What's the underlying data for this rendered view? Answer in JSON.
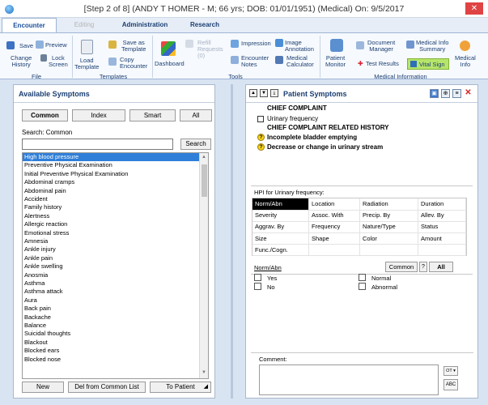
{
  "window": {
    "title": "[Step 2 of 8] (ANDY T HOMER - M; 66 yrs; DOB: 01/01/1951) (Medical) On: 9/5/2017",
    "close_glyph": "✕"
  },
  "tabs": [
    {
      "label": "Encounter"
    },
    {
      "label": "Editing"
    },
    {
      "label": "Administration"
    },
    {
      "label": "Research"
    }
  ],
  "ribbon": {
    "file": {
      "save": "Save",
      "preview": "Preview",
      "change_history": "Change\nHistory",
      "lock_screen": "Lock\nScreen",
      "group": "File"
    },
    "templates": {
      "load_template": "Load\nTemplate",
      "save_as_template": "Save as\nTemplate",
      "copy_encounter": "Copy\nEncounter",
      "group": "Templates"
    },
    "tools": {
      "dashboard": "Dashboard",
      "refill_requests": "Refill\nRequests\n(0)",
      "impression": "Impression",
      "image_annotation": "Image\nAnnotation",
      "encounter_notes": "Encounter\nNotes",
      "medical_calculator": "Medical\nCalculator",
      "group": "Tools"
    },
    "medical_info": {
      "patient_monitor": "Patient\nMonitor",
      "document_manager": "Document\nManager",
      "medical_info_summary": "Medical Info\nSummary",
      "test_results": "Test Results",
      "vital_sign": "Vital Sign",
      "medical_info": "Medical\nInfo",
      "group": "Medical Information"
    }
  },
  "available_symptoms": {
    "title": "Available Symptoms",
    "filters": [
      "Common",
      "Index",
      "Smart",
      "All"
    ],
    "search_label": "Search: Common",
    "search_value": "",
    "search_button": "Search",
    "items": [
      "High blood pressure",
      "Preventive Physical Examination",
      "Initial Preventive Physical Examination",
      "Abdominal cramps",
      "Abdominal pain",
      "Accident",
      "Family history",
      "Alertness",
      "Allergic reaction",
      "Emotional stress",
      "Amnesia",
      "Ankle injury",
      "Ankle pain",
      "Ankle swelling",
      "Anosmia",
      "Asthma",
      "Asthma attack",
      "Aura",
      "Back pain",
      "Backache",
      "Balance",
      "Suicidal thoughts",
      "Blackout",
      "Blocked ears",
      "Blocked nose"
    ],
    "selected_index": 0,
    "buttons": {
      "new": "New",
      "del_from_common": "Del from Common List",
      "to_patient": "To Patient"
    }
  },
  "patient_symptoms": {
    "title": "Patient Symptoms",
    "chief_complaint_header": "CHIEF COMPLAINT",
    "chief_complaint_item": "Urinary frequency",
    "related_header": "CHIEF COMPLAINT RELATED HISTORY",
    "related_items": [
      "Incomplete bladder emptying",
      "Decrease or change in urinary stream"
    ],
    "hpi_label": "HPI for Urinary frequency:",
    "hpi_grid": [
      [
        "Norm/Abn",
        "Location",
        "Radiation",
        "Duration"
      ],
      [
        "Severity",
        "Assoc. With",
        "Precip. By",
        "Allev. By"
      ],
      [
        "Aggrav. By",
        "Frequency",
        "Nature/Type",
        "Status"
      ],
      [
        "Size",
        "Shape",
        "Color",
        "Amount"
      ],
      [
        "Func./Cogn.",
        "",
        "",
        ""
      ]
    ],
    "norm_abn_title": "Norm/Abn",
    "common_button": "Common",
    "q_button": "?",
    "all_button": "All",
    "options_left": [
      "Yes",
      "No"
    ],
    "options_right": [
      "Normal",
      "Abnormal"
    ],
    "comment_label": "Comment:",
    "comment_value": ""
  }
}
